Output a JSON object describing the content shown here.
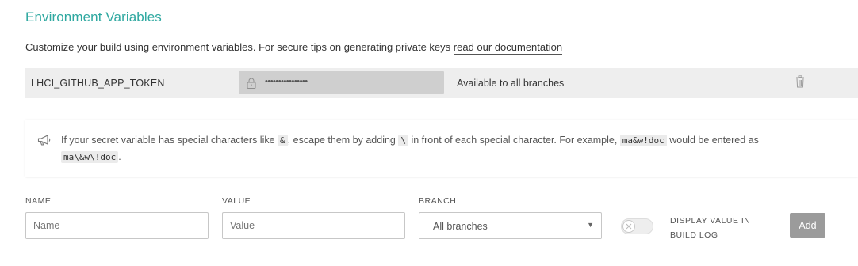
{
  "section": {
    "title": "Environment Variables",
    "intro_text": "Customize your build using environment variables. For secure tips on generating private keys ",
    "intro_link": "read our documentation"
  },
  "variables": [
    {
      "name": "LHCI_GITHUB_APP_TOKEN",
      "masked_value": "••••••••••••••••",
      "branch": "Available to all branches"
    }
  ],
  "notice": {
    "part1": "If your secret variable has special characters like ",
    "code1": "&",
    "part2": ", escape them by adding ",
    "code2": "\\",
    "part3": " in front of each special character. For example, ",
    "code3": "ma&w!doc",
    "part4": " would be entered as",
    "code4": "ma\\&w\\!doc",
    "part5": "."
  },
  "form": {
    "name_label": "NAME",
    "name_placeholder": "Name",
    "value_label": "VALUE",
    "value_placeholder": "Value",
    "branch_label": "BRANCH",
    "branch_selected": "All branches",
    "toggle_label": "DISPLAY VALUE IN BUILD LOG",
    "toggle_on": false,
    "add_label": "Add"
  },
  "colors": {
    "accent": "#2ea8a0",
    "row_background": "#eeeeee",
    "masked_background": "#cfcfcf",
    "button_disabled": "#9b9b9b"
  },
  "icons": {
    "masked_value": "lock-icon",
    "delete": "trash-icon",
    "notice": "megaphone-icon",
    "toggle_off": "x-icon",
    "dropdown": "caret-down-icon"
  }
}
